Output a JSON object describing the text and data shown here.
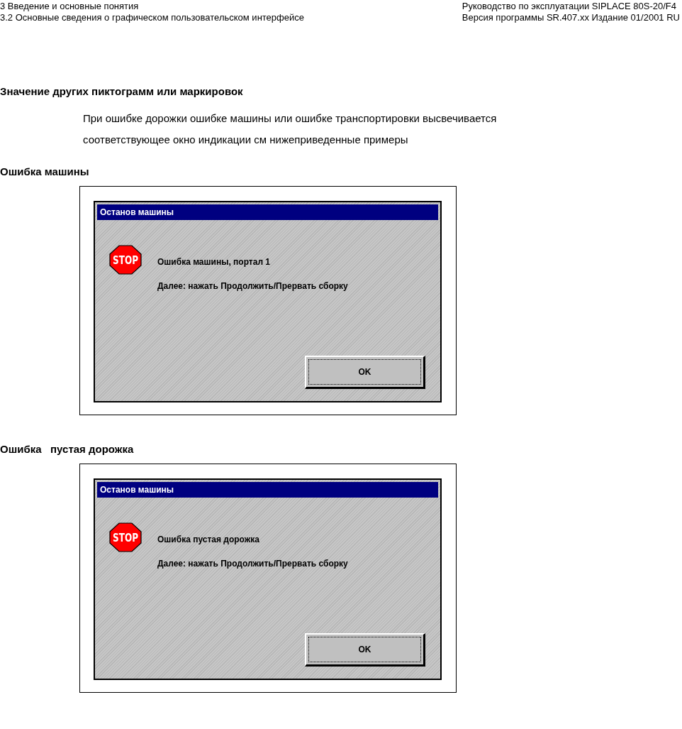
{
  "header": {
    "left": [
      "3 Введение и основные понятия",
      "3.2 Основные сведения о графическом пользовательском интерфейсе"
    ],
    "right": [
      "Руководство по эксплуатации SIPLACE 80S-20/F4",
      "Версия программы SR.407.xx  Издание 01/2001 RU"
    ]
  },
  "section": {
    "heading": "Значение других пиктограмм или маркировок",
    "paragraph": [
      "При ошибке дорожки  ошибке машины или ошибке транспортировки высвечивается",
      "соответствующее окно индикации  см  нижеприведенные примеры"
    ]
  },
  "examples": [
    {
      "heading": "Ошибка машины",
      "dialog": {
        "title": "Останов машины",
        "icon_text": "STOP",
        "messages": [
          "Ошибка машины, портал 1",
          "Далее: нажать Продолжить/Прервать сборку"
        ],
        "button": "OK"
      }
    },
    {
      "heading": "Ошибка   пустая дорожка",
      "dialog": {
        "title": "Останов машины",
        "icon_text": "STOP",
        "messages": [
          "Ошибка пустая дорожка",
          "Далее: нажать Продолжить/Прервать сборку"
        ],
        "button": "OK"
      }
    }
  ]
}
